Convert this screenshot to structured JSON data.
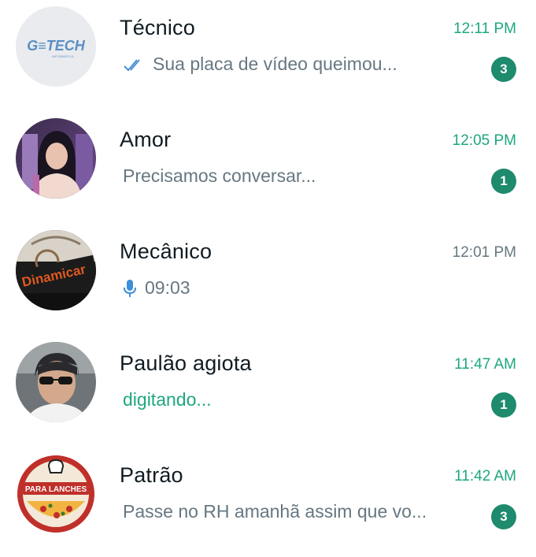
{
  "colors": {
    "accent": "#1da781",
    "badge": "#1e8a6e",
    "name_text": "#111b21",
    "muted_text": "#667781",
    "read_tick": "#4a8fd6",
    "mic": "#3d8fd8"
  },
  "chats": [
    {
      "name": "Técnico",
      "time": "12:11 PM",
      "preview": "Sua placa de vídeo queimou...",
      "preview_icon": "double-check-icon",
      "unread": "3",
      "avatar_text": "G≡TECH",
      "avatar_subtext": "INFORMÁTICA"
    },
    {
      "name": "Amor",
      "time": "12:05 PM",
      "preview": "Precisamos conversar...",
      "unread": "1"
    },
    {
      "name": "Mecânico",
      "time": "12:01 PM",
      "preview": "09:03",
      "preview_icon": "microphone-icon",
      "avatar_text": "Dinamicar"
    },
    {
      "name": "Paulão agiota",
      "time": "11:47 AM",
      "preview": "digitando...",
      "unread": "1"
    },
    {
      "name": "Patrão",
      "time": "11:42 AM",
      "preview": "Passe no RH amanhã assim que vo...",
      "unread": "3",
      "avatar_text": "PARA LANCHES"
    }
  ]
}
